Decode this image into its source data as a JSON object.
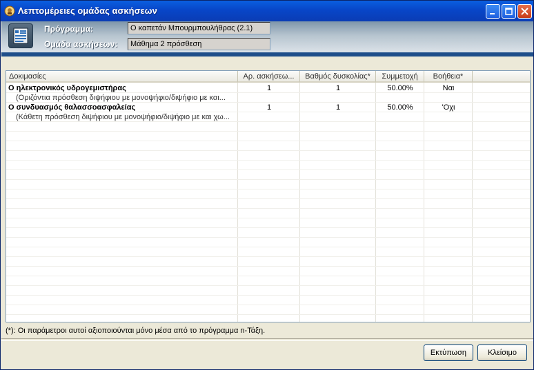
{
  "window": {
    "title": "Λεπτομέρειες ομάδας ασκήσεων"
  },
  "header": {
    "program_label": "Πρόγραμμα:",
    "program_value": "Ο καπετάν Μπουρμπουλήθρας (2.1)",
    "group_label": "Ομάδα ασκήσεων:",
    "group_value": "Μάθημα 2 πρόσθεση"
  },
  "table": {
    "columns": [
      "Δοκιμασίες",
      "Αρ. ασκήσεω...",
      "Βαθμός δυσκολίας*",
      "Συμμετοχή",
      "Βοήθεια*"
    ],
    "rows": [
      {
        "name": "Ο ηλεκτρονικός υδρογεμιστήρας",
        "description": "(Οριζόντια πρόσθεση διψήφιου με μονοψήφιο/διψήφιο με και...",
        "exercises": "1",
        "difficulty": "1",
        "participation": "50.00%",
        "help": "Ναι"
      },
      {
        "name": "Ο συνδυασμός θαλασσοασφαλείας",
        "description": "(Κάθετη πρόσθεση διψήφιου με μονοψήφιο/διψήφιο με και χω...",
        "exercises": "1",
        "difficulty": "1",
        "participation": "50.00%",
        "help": "'Οχι"
      }
    ]
  },
  "footnote": "(*): Οι παράμετροι αυτοί αξιοποιούνται μόνο μέσα από το πρόγραμμα n-Τάξη.",
  "buttons": {
    "print": "Εκτύπωση",
    "close": "Κλείσιμο"
  },
  "colors": {
    "titlebar": "#0846c8",
    "header_band": "#9fb0c0",
    "header_rule": "#1e4e8a"
  }
}
